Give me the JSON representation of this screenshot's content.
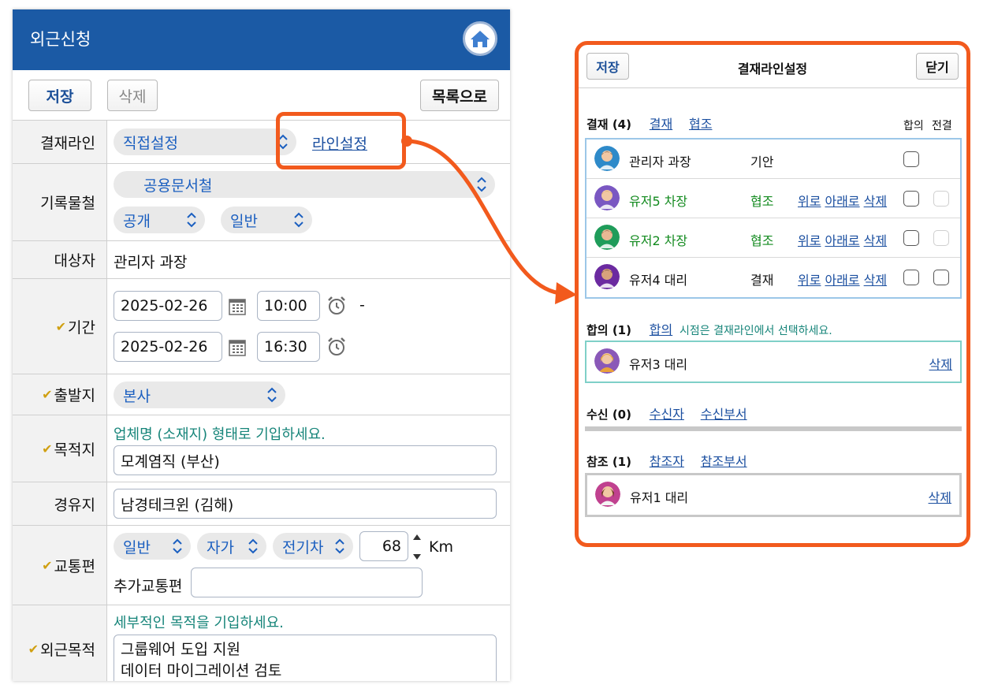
{
  "form": {
    "title": "외근신청",
    "toolbar": {
      "save": "저장",
      "delete": "삭제",
      "list": "목록으로"
    },
    "approval_line": {
      "label": "결재라인",
      "select": "직접설정",
      "link": "라인설정"
    },
    "records": {
      "label": "기록물철",
      "folder": "공용문서철",
      "visibility": "공개",
      "type": "일반"
    },
    "target": {
      "label": "대상자",
      "value": "관리자 과장"
    },
    "period": {
      "label": "기간",
      "start_date": "2025-02-26",
      "start_time": "10:00",
      "dash": "-",
      "end_date": "2025-02-26",
      "end_time": "16:30"
    },
    "departure": {
      "label": "출발지",
      "value": "본사"
    },
    "destination": {
      "label": "목적지",
      "hint": "업체명 (소재지) 형태로 기입하세요.",
      "value": "모계염직 (부산)"
    },
    "via": {
      "label": "경유지",
      "value": "남경테크윈 (김해)"
    },
    "transport": {
      "label": "교통편",
      "type": "일반",
      "owner": "자가",
      "vehicle": "전기차",
      "distance": "68",
      "unit": "Km",
      "extra_label": "추가교통편",
      "extra_value": ""
    },
    "purpose": {
      "label": "외근목적",
      "hint": "세부적인 목적을 기입하세요.",
      "line1": "그룹웨어 도입 지원",
      "line2": "데이터 마이그레이션 검토"
    }
  },
  "line_panel": {
    "save": "저장",
    "title": "결재라인설정",
    "close": "닫기",
    "approval": {
      "heading": "결재 (4)",
      "link1": "결재",
      "link2": "협조",
      "col_agree": "합의",
      "col_decide": "전결",
      "rows": [
        {
          "name": "관리자 과장",
          "role": "기안",
          "actions": false,
          "green": false,
          "cb1": true,
          "cb2": false,
          "cb2_enabled": false
        },
        {
          "name": "유저5 차장",
          "role": "협조",
          "actions": true,
          "green": true,
          "cb1": true,
          "cb2": true,
          "cb2_enabled": false
        },
        {
          "name": "유저2 차장",
          "role": "협조",
          "actions": true,
          "green": true,
          "cb1": true,
          "cb2": true,
          "cb2_enabled": false
        },
        {
          "name": "유저4 대리",
          "role": "결재",
          "actions": true,
          "green": false,
          "cb1": true,
          "cb2": true,
          "cb2_enabled": true
        }
      ],
      "act_up": "위로",
      "act_down": "아래로",
      "act_delete": "삭제"
    },
    "agreement": {
      "heading": "합의 (1)",
      "link": "합의",
      "note": "시점은 결재라인에서 선택하세요.",
      "row_name": "유저3 대리",
      "row_delete": "삭제"
    },
    "receive": {
      "heading": "수신 (0)",
      "link1": "수신자",
      "link2": "수신부서"
    },
    "reference": {
      "heading": "참조 (1)",
      "link1": "참조자",
      "link2": "참조부서",
      "row_name": "유저1 대리",
      "row_delete": "삭제"
    }
  },
  "colors": {
    "header_blue": "#1b5aa5",
    "accent_orange": "#f25a1d",
    "teal_hint": "#17857a",
    "green_role": "#128a1e",
    "link_blue": "#1b4fa0"
  }
}
